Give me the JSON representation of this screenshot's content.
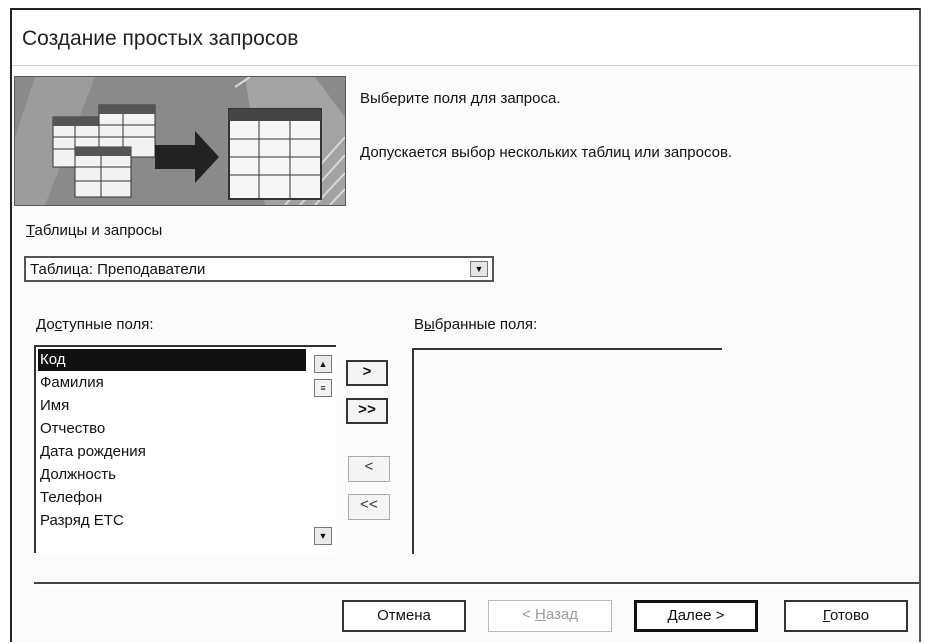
{
  "window": {
    "title": "Создание простых запросов"
  },
  "description": {
    "line1": "Выберите поля для запроса.",
    "line2": "Допускается выбор нескольких таблиц или запросов."
  },
  "tables_label": {
    "first": "Т",
    "rest": "аблицы и запросы"
  },
  "tables_combo": {
    "value": "Таблица: Преподаватели"
  },
  "available_label": {
    "pre": "До",
    "accel": "с",
    "post": "тупные поля:"
  },
  "selected_label": {
    "pre": "В",
    "accel": "ы",
    "post": "бранные поля:"
  },
  "available_fields": [
    "Код",
    "Фамилия",
    "Имя",
    "Отчество",
    "Дата рождения",
    "Должность",
    "Телефон",
    "Разряд ЕТС"
  ],
  "move_buttons": {
    "add_one": ">",
    "add_all": ">>",
    "remove_one": "<",
    "remove_all": "<<"
  },
  "buttons": {
    "cancel": "Отмена",
    "back": {
      "pre": "< ",
      "accel": "Н",
      "post": "азад"
    },
    "next": {
      "accel": "Д",
      "post": "алее >"
    },
    "finish": {
      "accel": "Г",
      "post": "отово"
    }
  },
  "icons": {
    "combo_arrow": "chevron-down-icon",
    "scroll_up": "scroll-up-icon",
    "scroll_down": "scroll-down-icon",
    "scroll_thumb": "scroll-thumb-icon",
    "wizard_picture": "table-merge-illustration"
  }
}
